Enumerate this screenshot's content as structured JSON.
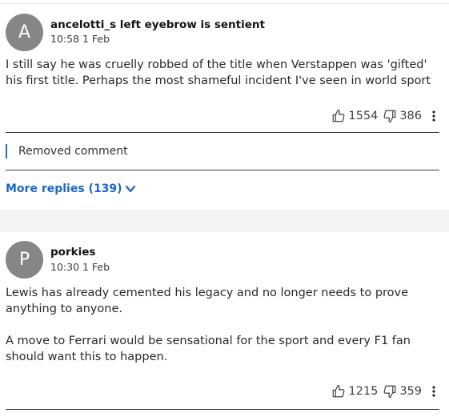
{
  "comments": [
    {
      "avatar_letter": "A",
      "author": "ancelotti_s left eyebrow is sentient",
      "timestamp": "10:58 1 Feb",
      "paragraphs": [
        "I still say he was cruelly robbed of the title when Verstappen was 'gifted' his first title. Perhaps the most shameful incident I've seen in world sport"
      ],
      "likes": "1554",
      "dislikes": "386",
      "replies": {
        "removed_label": "Removed comment",
        "more_replies_label": "More replies (139)"
      }
    },
    {
      "avatar_letter": "P",
      "author": "porkies",
      "timestamp": "10:30 1 Feb",
      "paragraphs": [
        "Lewis has already cemented his legacy and no longer needs to prove anything to anyone.",
        "A move to Ferrari would be sensational for the sport and every F1 fan should want this to happen."
      ],
      "likes": "1215",
      "dislikes": "359"
    }
  ],
  "icons": {
    "like": "thumbs-up-icon",
    "dislike": "thumbs-down-icon",
    "more": "vertical-ellipsis-icon",
    "expand": "chevron-down-icon"
  },
  "colors": {
    "link": "#1b66c9",
    "avatar_bg": "#868686",
    "accent_bar": "#1c6bd1"
  }
}
